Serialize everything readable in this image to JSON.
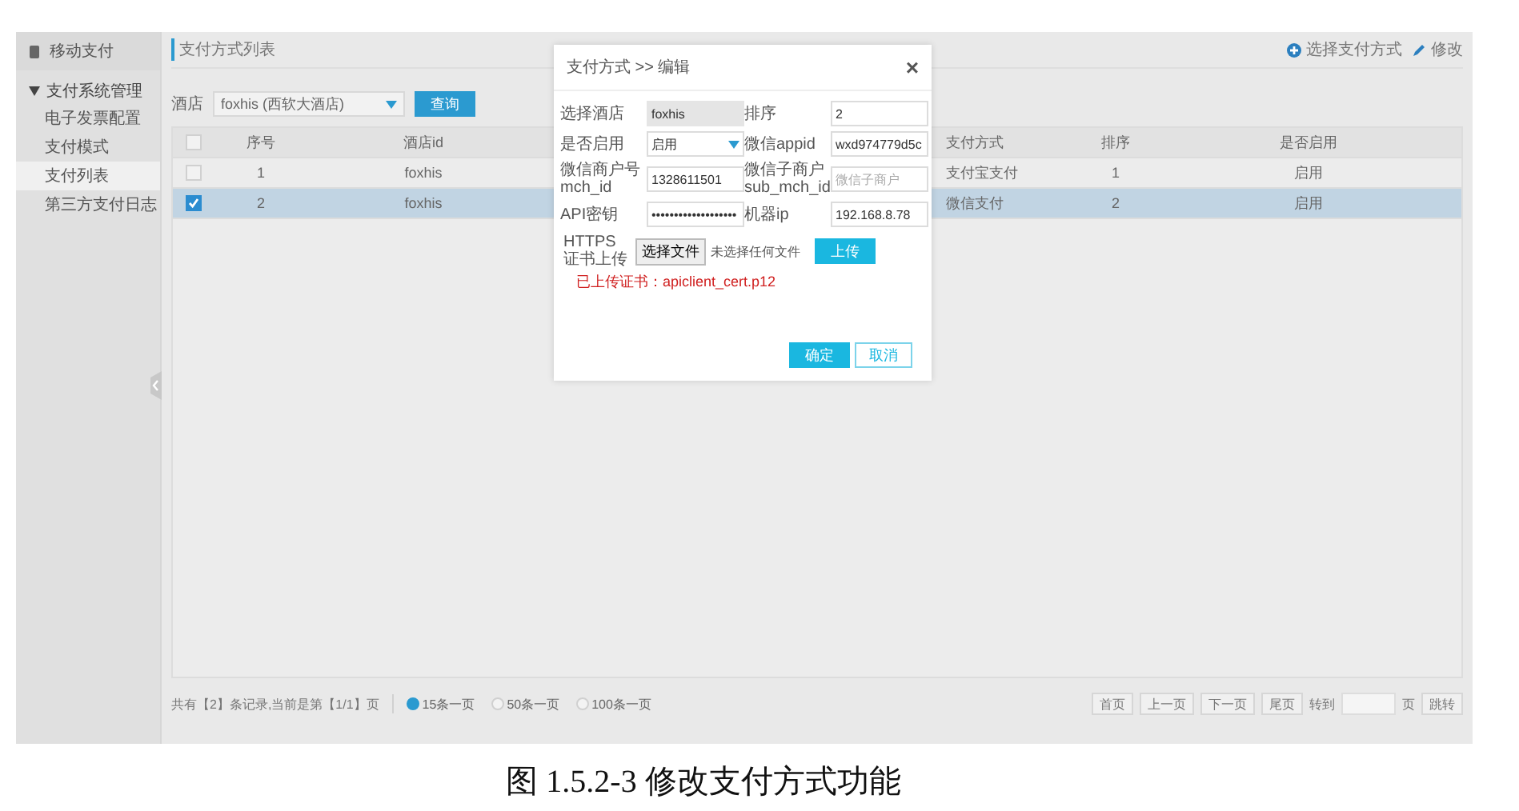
{
  "sidebar": {
    "title": "移动支付",
    "groups": [
      {
        "label": "支付系统管理",
        "expanded": true,
        "children": [
          {
            "label": "电子发票配置",
            "selected": false
          },
          {
            "label": "支付模式",
            "selected": false
          },
          {
            "label": "支付列表",
            "selected": true
          },
          {
            "label": "第三方支付日志",
            "selected": false
          }
        ]
      }
    ]
  },
  "breadcrumb": "支付方式列表",
  "actions": [
    {
      "kind": "add",
      "label": "选择支付方式"
    },
    {
      "kind": "edit",
      "label": "修改"
    }
  ],
  "filter": {
    "label": "酒店",
    "value": "foxhis (西软大酒店)",
    "button": "查询"
  },
  "table": {
    "columns": [
      "序号",
      "酒店id",
      "支付方式",
      "排序",
      "是否启用"
    ],
    "header_checked": false,
    "rows": [
      {
        "selected": false,
        "checked": false,
        "cells": [
          "1",
          "foxhis",
          "支付宝支付",
          "1",
          "启用"
        ]
      },
      {
        "selected": true,
        "checked": true,
        "cells": [
          "2",
          "foxhis",
          "微信支付",
          "2",
          "启用"
        ]
      }
    ]
  },
  "pagination": {
    "summary": "共有【2】条记录,当前是第【1/1】页",
    "page_sizes": [
      {
        "label": "15条一页",
        "selected": true
      },
      {
        "label": "50条一页",
        "selected": false
      },
      {
        "label": "100条一页",
        "selected": false
      }
    ],
    "buttons": [
      "首页",
      "上一页",
      "下一页",
      "尾页"
    ],
    "goto_label": "转到",
    "page_unit": "页",
    "jump": "跳转"
  },
  "dialog": {
    "title": "支付方式 >> 编辑",
    "close": "×",
    "fields": [
      {
        "kind": "readonly",
        "label": "选择酒店",
        "value": "foxhis"
      },
      {
        "kind": "input",
        "label": "排序",
        "value": "2"
      },
      {
        "kind": "select",
        "label": "是否启用",
        "value": "启用"
      },
      {
        "kind": "input",
        "label": "微信appid",
        "value": "wxd974779d5c"
      },
      {
        "kind": "input",
        "label": "微信商户号 mch_id",
        "value": "1328611501"
      },
      {
        "kind": "placeholder",
        "label": "微信子商户 sub_mch_id",
        "placeholder": "微信子商户"
      },
      {
        "kind": "input",
        "label": "API密钥",
        "value": "•••••••••••••••••••"
      },
      {
        "kind": "input",
        "label": "机器ip",
        "value": "192.168.8.78"
      }
    ],
    "file": {
      "label": "HTTPS证书上传",
      "choose": "选择文件",
      "status": "未选择任何文件",
      "upload": "上传"
    },
    "uploaded": "已上传证书：apiclient_cert.p12",
    "ok": "确定",
    "cancel": "取消"
  },
  "caption": "图 1.5.2-3 修改支付方式功能"
}
